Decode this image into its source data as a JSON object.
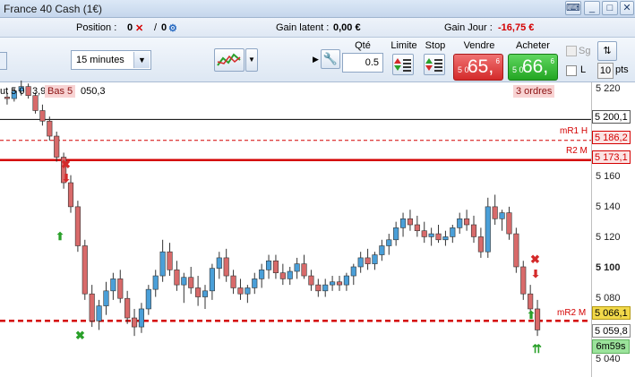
{
  "window": {
    "title": "France 40 Cash (1€)"
  },
  "infobar": {
    "position_label": "Position :",
    "position_long": "0",
    "position_sep": "/",
    "position_short": "0",
    "unrealized_label": "Gain latent :",
    "unrealized_value": "0,00 €",
    "daily_label": "Gain Jour :",
    "daily_value": "-16,75 €"
  },
  "toolbar": {
    "timeframe": "15 minutes",
    "qty_label": "Qté",
    "qty_value": "0.5",
    "limit_label": "Limite",
    "stop_label": "Stop",
    "sell_label": "Vendre",
    "buy_label": "Acheter",
    "sell_price_prefix": "5 0",
    "sell_price_main": "65,",
    "sell_price_sup": "6",
    "buy_price_prefix": "5 0",
    "buy_price_main": "66,",
    "buy_price_sup": "6",
    "sg_label": "Sg",
    "l_label": "L",
    "pts_value": "10",
    "pts_label": "pts"
  },
  "chart": {
    "top_left_note": "ut 5 0",
    "top_left_note2": "3,9",
    "top_left_note3": "Bas 5",
    "top_left_note4": "050,3",
    "orders_badge": "3 ordres",
    "axis_ticks": [
      {
        "value": "5 220",
        "bold": false
      },
      {
        "value": "5 160",
        "bold": false
      },
      {
        "value": "5 140",
        "bold": false
      },
      {
        "value": "5 120",
        "bold": false
      },
      {
        "value": "5 100",
        "bold": true
      },
      {
        "value": "5 080",
        "bold": false
      },
      {
        "value": "5 040",
        "bold": false
      }
    ],
    "levels": [
      {
        "label": "",
        "price": "5 200,1",
        "color": "#000000",
        "style": "solid"
      },
      {
        "label": "mR1 H",
        "price": "5 186,2",
        "color": "#d40000",
        "style": "dashed"
      },
      {
        "label": "R2 M",
        "price": "5 173,1",
        "color": "#d40000",
        "style": "solid-thick"
      },
      {
        "label": "mR2 M",
        "price": "5 066,1",
        "color": "#d40000",
        "style": "dashed-thick"
      },
      {
        "label": "",
        "price": "5 059,8",
        "color": "#000000",
        "style": "none"
      }
    ],
    "clock": "6m59s",
    "colors": {
      "bull": "#4a9fd8",
      "bear": "#d86a6a",
      "level_red": "#d40000"
    }
  },
  "chart_data": {
    "type": "candlestick",
    "timeframe": "15 minutes",
    "ylim": [
      5030,
      5230
    ],
    "ticks": [
      5220,
      5160,
      5140,
      5120,
      5100,
      5080,
      5040
    ],
    "levels": [
      5200.1,
      5186.2,
      5173.1,
      5066.1
    ],
    "current_price": 5059.8,
    "candles": [
      [
        5215,
        5218,
        5210,
        5214
      ],
      [
        5214,
        5221,
        5212,
        5219
      ],
      [
        5219,
        5226,
        5216,
        5222
      ],
      [
        5222,
        5224,
        5214,
        5216
      ],
      [
        5216,
        5218,
        5204,
        5206
      ],
      [
        5206,
        5210,
        5196,
        5199
      ],
      [
        5199,
        5202,
        5186,
        5189
      ],
      [
        5189,
        5192,
        5172,
        5175
      ],
      [
        5175,
        5178,
        5154,
        5158
      ],
      [
        5158,
        5163,
        5138,
        5142
      ],
      [
        5142,
        5146,
        5112,
        5116
      ],
      [
        5116,
        5120,
        5080,
        5084
      ],
      [
        5084,
        5090,
        5062,
        5066
      ],
      [
        5066,
        5080,
        5060,
        5076
      ],
      [
        5076,
        5092,
        5070,
        5086
      ],
      [
        5086,
        5098,
        5080,
        5094
      ],
      [
        5094,
        5100,
        5078,
        5081
      ],
      [
        5081,
        5086,
        5064,
        5068
      ],
      [
        5068,
        5074,
        5056,
        5062
      ],
      [
        5062,
        5078,
        5058,
        5074
      ],
      [
        5074,
        5090,
        5070,
        5087
      ],
      [
        5087,
        5100,
        5082,
        5096
      ],
      [
        5096,
        5120,
        5092,
        5112
      ],
      [
        5112,
        5118,
        5096,
        5100
      ],
      [
        5100,
        5106,
        5086,
        5090
      ],
      [
        5090,
        5098,
        5078,
        5095
      ],
      [
        5095,
        5102,
        5084,
        5088
      ],
      [
        5088,
        5096,
        5076,
        5082
      ],
      [
        5082,
        5090,
        5074,
        5086
      ],
      [
        5086,
        5104,
        5080,
        5101
      ],
      [
        5101,
        5112,
        5094,
        5108
      ],
      [
        5108,
        5114,
        5092,
        5096
      ],
      [
        5096,
        5100,
        5084,
        5088
      ],
      [
        5088,
        5094,
        5080,
        5084
      ],
      [
        5084,
        5090,
        5078,
        5088
      ],
      [
        5088,
        5098,
        5084,
        5094
      ],
      [
        5094,
        5104,
        5088,
        5100
      ],
      [
        5100,
        5110,
        5094,
        5106
      ],
      [
        5106,
        5110,
        5094,
        5098
      ],
      [
        5098,
        5104,
        5090,
        5094
      ],
      [
        5094,
        5102,
        5090,
        5099
      ],
      [
        5099,
        5108,
        5094,
        5104
      ],
      [
        5104,
        5110,
        5094,
        5096
      ],
      [
        5096,
        5100,
        5086,
        5090
      ],
      [
        5090,
        5094,
        5082,
        5086
      ],
      [
        5086,
        5094,
        5082,
        5090
      ],
      [
        5090,
        5096,
        5086,
        5092
      ],
      [
        5092,
        5096,
        5086,
        5090
      ],
      [
        5090,
        5098,
        5086,
        5096
      ],
      [
        5096,
        5104,
        5090,
        5102
      ],
      [
        5102,
        5112,
        5098,
        5108
      ],
      [
        5108,
        5114,
        5100,
        5104
      ],
      [
        5104,
        5112,
        5100,
        5110
      ],
      [
        5110,
        5120,
        5106,
        5116
      ],
      [
        5116,
        5124,
        5110,
        5120
      ],
      [
        5120,
        5132,
        5116,
        5128
      ],
      [
        5128,
        5138,
        5122,
        5134
      ],
      [
        5134,
        5140,
        5126,
        5130
      ],
      [
        5130,
        5136,
        5122,
        5126
      ],
      [
        5126,
        5132,
        5118,
        5122
      ],
      [
        5122,
        5128,
        5116,
        5124
      ],
      [
        5124,
        5130,
        5118,
        5120
      ],
      [
        5120,
        5126,
        5116,
        5122
      ],
      [
        5122,
        5130,
        5118,
        5128
      ],
      [
        5128,
        5138,
        5124,
        5134
      ],
      [
        5134,
        5140,
        5126,
        5130
      ],
      [
        5130,
        5136,
        5118,
        5122
      ],
      [
        5122,
        5128,
        5108,
        5112
      ],
      [
        5112,
        5148,
        5108,
        5142
      ],
      [
        5142,
        5150,
        5130,
        5134
      ],
      [
        5134,
        5140,
        5126,
        5138
      ],
      [
        5138,
        5142,
        5120,
        5124
      ],
      [
        5124,
        5128,
        5098,
        5102
      ],
      [
        5102,
        5106,
        5080,
        5084
      ],
      [
        5084,
        5090,
        5068,
        5074
      ],
      [
        5074,
        5080,
        5056,
        5060
      ]
    ]
  }
}
